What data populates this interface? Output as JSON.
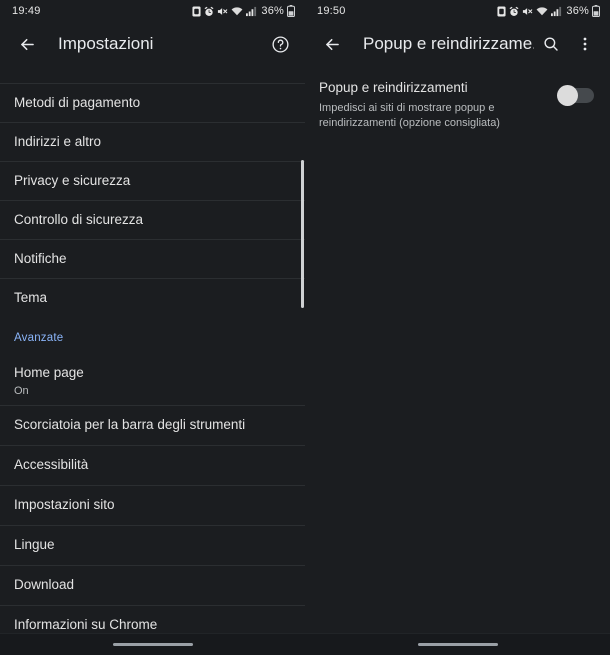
{
  "theme": {
    "background": "#1b1d20",
    "divider": "#2b2e31",
    "primary_text": "#e3e3e3",
    "secondary_text": "#b9bcbe",
    "accent_blue": "#8ab4f8",
    "scrollbar": "#cfd1d3",
    "switch_track": "#45494d",
    "switch_knob": "#dcdcdc"
  },
  "left_screen": {
    "status_bar": {
      "time": "19:49",
      "battery_percent": "36%",
      "icons": [
        "sim-card-icon",
        "alarm-icon",
        "mute-icon",
        "wifi-icon",
        "signal-icon",
        "battery-icon"
      ]
    },
    "app_bar": {
      "back_label": "back-arrow-icon",
      "title": "Impostazioni",
      "action_icon": "help-circle-icon"
    },
    "list": [
      {
        "label": "Metodi di pagamento",
        "sub": ""
      },
      {
        "label": "Indirizzi e altro",
        "sub": ""
      },
      {
        "label": "Privacy e sicurezza",
        "sub": ""
      },
      {
        "label": "Controllo di sicurezza",
        "sub": ""
      },
      {
        "label": "Notifiche",
        "sub": ""
      },
      {
        "label": "Tema",
        "sub": ""
      }
    ],
    "section_header": "Avanzate",
    "list_advanced": [
      {
        "label": "Home page",
        "sub": "On"
      },
      {
        "label": "Scorciatoia per la barra degli strumenti",
        "sub": ""
      },
      {
        "label": "Accessibilità",
        "sub": ""
      },
      {
        "label": "Impostazioni sito",
        "sub": ""
      },
      {
        "label": "Lingue",
        "sub": ""
      },
      {
        "label": "Download",
        "sub": ""
      },
      {
        "label": "Informazioni su Chrome",
        "sub": ""
      }
    ]
  },
  "right_screen": {
    "status_bar": {
      "time": "19:50",
      "battery_percent": "36%",
      "icons": [
        "sim-card-icon",
        "alarm-icon",
        "mute-icon",
        "wifi-icon",
        "signal-icon",
        "battery-icon"
      ]
    },
    "app_bar": {
      "back_label": "back-arrow-icon",
      "title": "Popup e reindirizzame...",
      "search_icon": "search-icon",
      "overflow_icon": "more-vertical-icon"
    },
    "preference": {
      "title": "Popup e reindirizzamenti",
      "description": "Impedisci ai siti di mostrare popup e reindirizzamenti (opzione consigliata)",
      "toggle_state": "off"
    }
  }
}
